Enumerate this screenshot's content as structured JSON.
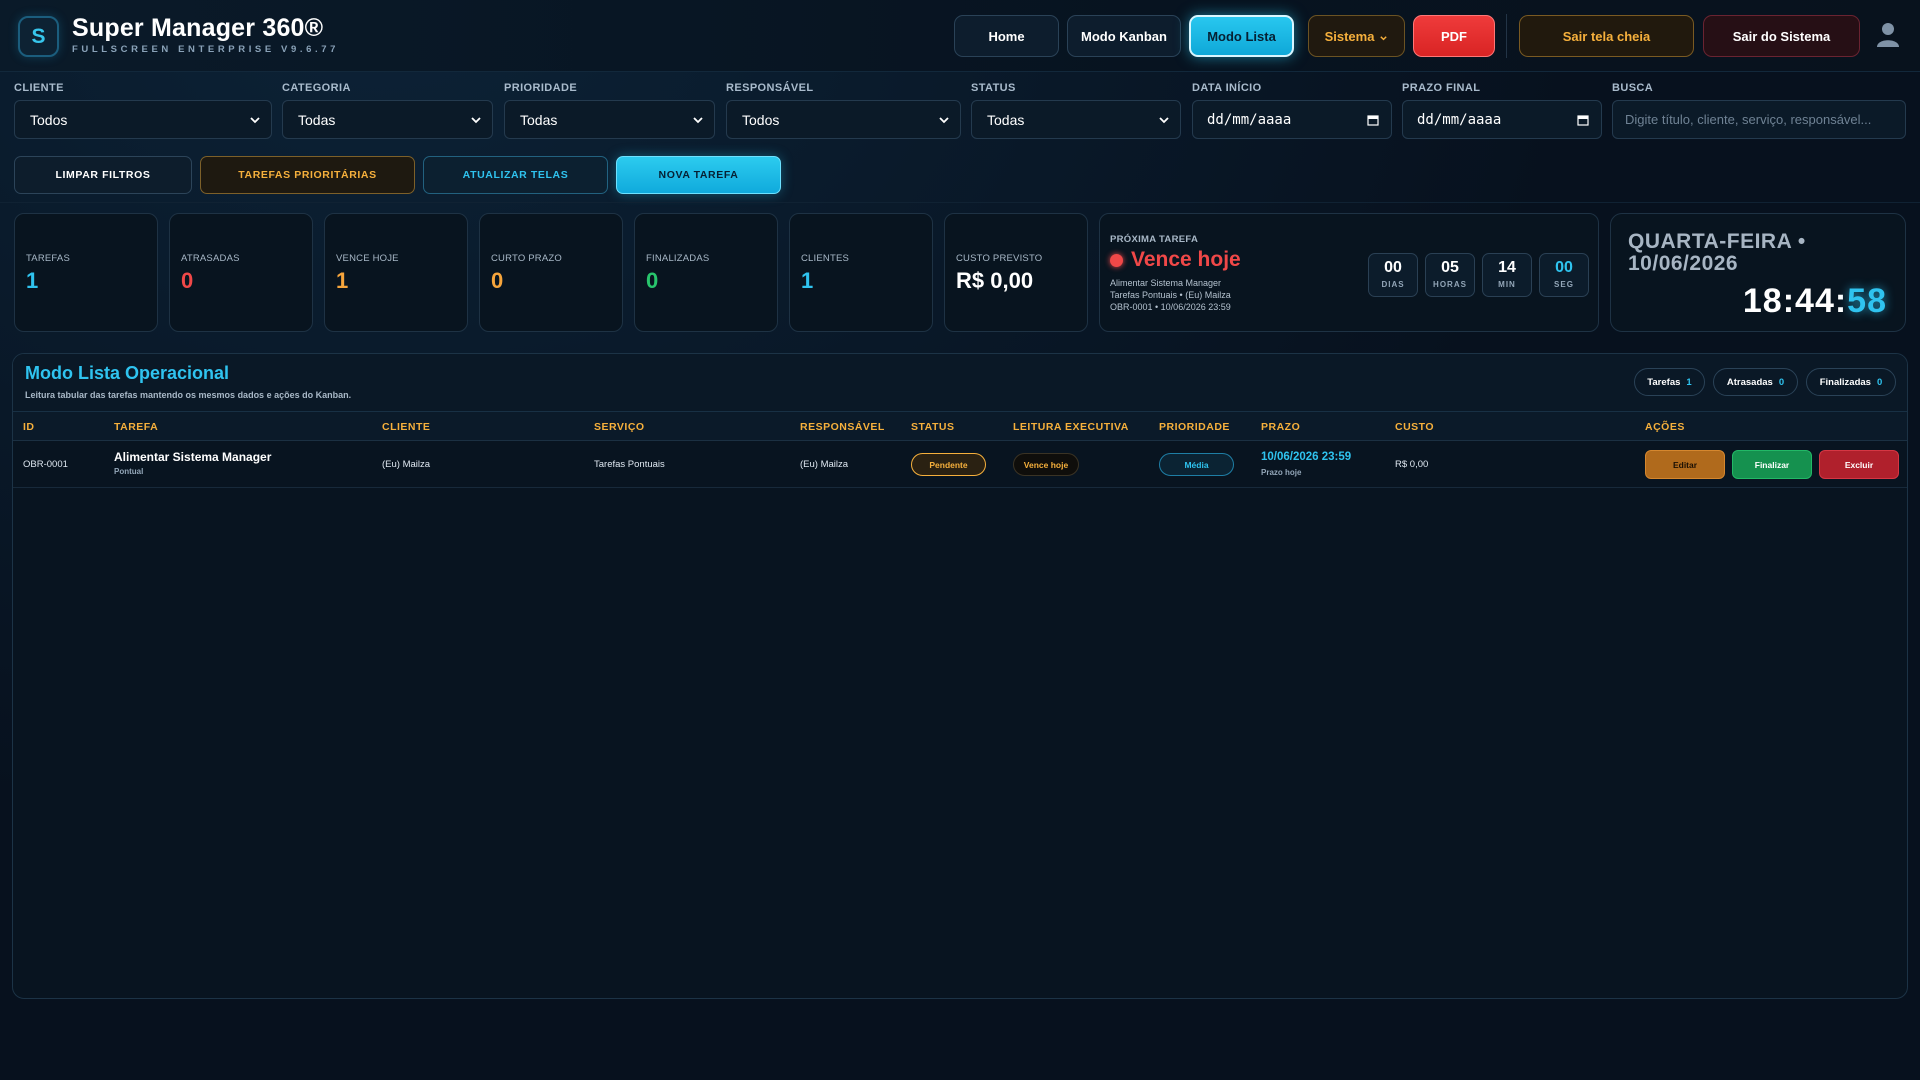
{
  "header": {
    "logo_letter": "S",
    "title": "Super Manager 360®",
    "subtitle": "FULLSCREEN ENTERPRISE V9.6.77",
    "nav": {
      "home": "Home",
      "kanban": "Modo Kanban",
      "list": "Modo Lista",
      "system": "Sistema",
      "pdf": "PDF",
      "exit_fullscreen": "Sair tela cheia",
      "logout": "Sair do Sistema"
    }
  },
  "filters": {
    "client": {
      "label": "CLIENTE",
      "value": "Todos"
    },
    "category": {
      "label": "CATEGORIA",
      "value": "Todas"
    },
    "priority": {
      "label": "PRIORIDADE",
      "value": "Todas"
    },
    "owner": {
      "label": "RESPONSÁVEL",
      "value": "Todos"
    },
    "status": {
      "label": "STATUS",
      "value": "Todas"
    },
    "start_date": {
      "label": "DATA INÍCIO",
      "value": "dd/mm/aaaa"
    },
    "deadline": {
      "label": "PRAZO FINAL",
      "value": "dd/mm/aaaa"
    },
    "search": {
      "label": "BUSCA",
      "placeholder": "Digite título, cliente, serviço, responsável..."
    }
  },
  "actions": {
    "clear": "LIMPAR FILTROS",
    "priority_tasks": "TAREFAS PRIORITÁRIAS",
    "refresh": "ATUALIZAR TELAS",
    "new_task": "NOVA TAREFA"
  },
  "stats": [
    {
      "label": "TAREFAS",
      "value": "1"
    },
    {
      "label": "ATRASADAS",
      "value": "0"
    },
    {
      "label": "VENCE HOJE",
      "value": "1"
    },
    {
      "label": "CURTO PRAZO",
      "value": "0"
    },
    {
      "label": "FINALIZADAS",
      "value": "0"
    },
    {
      "label": "CLIENTES",
      "value": "1"
    },
    {
      "label": "CUSTO PREVISTO",
      "value": "R$ 0,00"
    }
  ],
  "next_task": {
    "label": "PRÓXIMA TAREFA",
    "status": "Vence hoje",
    "line1": "Alimentar Sistema Manager",
    "line2": "Tarefas Pontuais • (Eu) Mailza",
    "line3": "OBR-0001 • 10/06/2026 23:59",
    "countdown": [
      {
        "num": "00",
        "unit": "DIAS"
      },
      {
        "num": "05",
        "unit": "HORAS"
      },
      {
        "num": "14",
        "unit": "MIN"
      },
      {
        "num": "00",
        "unit": "SEG"
      }
    ]
  },
  "date_card": {
    "date": "QUARTA-FEIRA • 10/06/2026",
    "clock_hm": "18:44:",
    "clock_s": "58"
  },
  "list_panel": {
    "title": "Modo Lista Operacional",
    "subtitle": "Leitura tabular das tarefas mantendo os mesmos dados e ações do Kanban.",
    "pills": [
      {
        "label": "Tarefas",
        "count": "1"
      },
      {
        "label": "Atrasadas",
        "count": "0"
      },
      {
        "label": "Finalizadas",
        "count": "0"
      }
    ],
    "columns": [
      "ID",
      "TAREFA",
      "CLIENTE",
      "SERVIÇO",
      "RESPONSÁVEL",
      "STATUS",
      "LEITURA EXECUTIVA",
      "PRIORIDADE",
      "PRAZO",
      "CUSTO",
      "AÇÕES"
    ],
    "rows": [
      {
        "id": "OBR-0001",
        "task": "Alimentar Sistema Manager",
        "task_type": "Pontual",
        "client": "(Eu) Mailza",
        "service": "Tarefas Pontuais",
        "owner": "(Eu) Mailza",
        "status": "Pendente",
        "executive": "Vence hoje",
        "priority": "Média",
        "deadline": "10/06/2026 23:59",
        "deadline_note": "Prazo hoje",
        "cost": "R$ 0,00",
        "btn_edit": "Editar",
        "btn_finish": "Finalizar",
        "btn_delete": "Excluir"
      }
    ]
  }
}
